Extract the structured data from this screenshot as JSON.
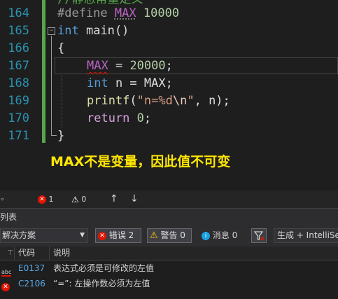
{
  "editor": {
    "line_numbers": [
      "164",
      "165",
      "166",
      "167",
      "168",
      "169",
      "170",
      "171"
    ],
    "top_partial_comment": "//静态常量定义",
    "lines": {
      "l164": {
        "directive": "#define",
        "macro": "MAX",
        "value": "10000"
      },
      "l165": {
        "type": "int",
        "name": "main()"
      },
      "l166": {
        "brace": "{"
      },
      "l167": {
        "macro": "MAX",
        "rest": " = ",
        "num": "20000",
        "semi": ";"
      },
      "l168": {
        "type": "int",
        "rest": " n = MAX;"
      },
      "l169": {
        "fn": "printf",
        "open": "(",
        "str1": "\"n=%d",
        "esc": "\\n",
        "str2": "\"",
        "rest": ", n);"
      },
      "l170": {
        "kw": "return",
        "sp": " ",
        "num": "0",
        "semi": ";"
      },
      "l171": {
        "brace": "}"
      }
    },
    "annotation": "MAX不是变量，因此值不可变"
  },
  "statusbar": {
    "left_glyph": "∘",
    "errors": "1",
    "warnings": "0",
    "up_arrow": "↑",
    "down_arrow": "↓"
  },
  "panel": {
    "title": "列表",
    "scope_dropdown": "解决方案",
    "errors_btn": "错误 2",
    "warnings_btn": "警告 0",
    "messages_btn": "消息 0",
    "build_dropdown": "生成 + IntelliSense"
  },
  "grid": {
    "headers": {
      "code": "代码",
      "desc": "说明"
    },
    "rows": [
      {
        "icon": "abc",
        "code": "E0137",
        "desc": "表达式必须是可修改的左值"
      },
      {
        "icon": "error",
        "code": "C2106",
        "desc": "“=”: 左操作数必须为左值"
      }
    ]
  },
  "colors": {
    "error": "#e51400",
    "warning": "#ffcc00",
    "info": "#1ba1e2",
    "annotation": "#ffe600",
    "gutter": "#57a64a"
  }
}
